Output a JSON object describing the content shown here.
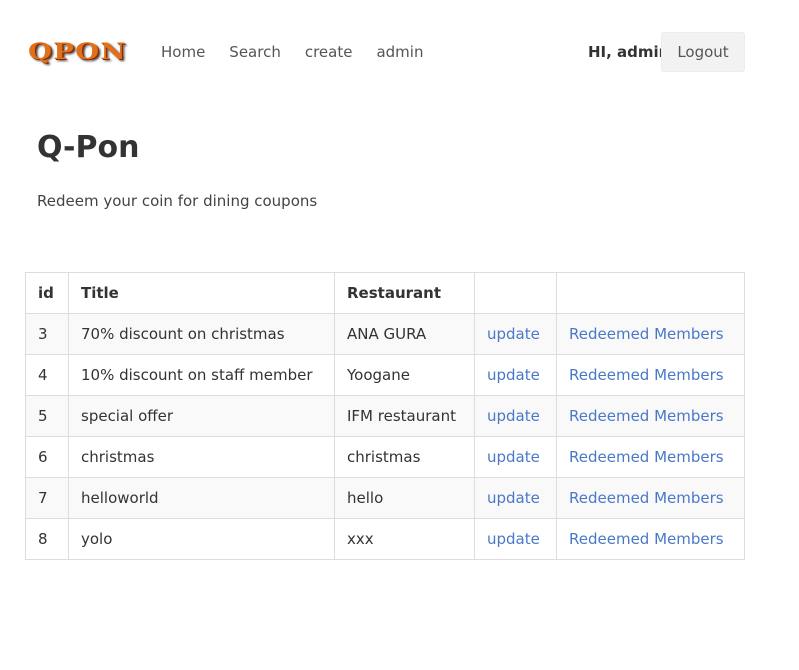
{
  "nav": {
    "logo_text": "QPON",
    "links": [
      {
        "label": "Home"
      },
      {
        "label": "Search"
      },
      {
        "label": "create"
      },
      {
        "label": "admin"
      }
    ],
    "greeting": "HI, admin",
    "logout_label": "Logout"
  },
  "main": {
    "title": "Q-Pon",
    "subtitle": "Redeem your coin for dining coupons"
  },
  "table": {
    "headers": [
      "id",
      "Title",
      "Restaurant",
      "",
      ""
    ],
    "rows": [
      {
        "id": "3",
        "title": "70% discount on christmas",
        "restaurant": "ANA GURA",
        "update": "update",
        "members": "Redeemed Members"
      },
      {
        "id": "4",
        "title": "10% discount on staff member",
        "restaurant": "Yoogane",
        "update": "update",
        "members": "Redeemed Members"
      },
      {
        "id": "5",
        "title": "special offer",
        "restaurant": "IFM restaurant",
        "update": "update",
        "members": "Redeemed Members"
      },
      {
        "id": "6",
        "title": "christmas",
        "restaurant": "christmas",
        "update": "update",
        "members": "Redeemed Members"
      },
      {
        "id": "7",
        "title": "helloworld",
        "restaurant": "hello",
        "update": "update",
        "members": "Redeemed Members"
      },
      {
        "id": "8",
        "title": "yolo",
        "restaurant": "xxx",
        "update": "update",
        "members": "Redeemed Members"
      }
    ]
  },
  "colors": {
    "link": "#4a78c8",
    "text": "#333333",
    "logo": "#e0701a",
    "button_bg": "#f2f2f2"
  }
}
